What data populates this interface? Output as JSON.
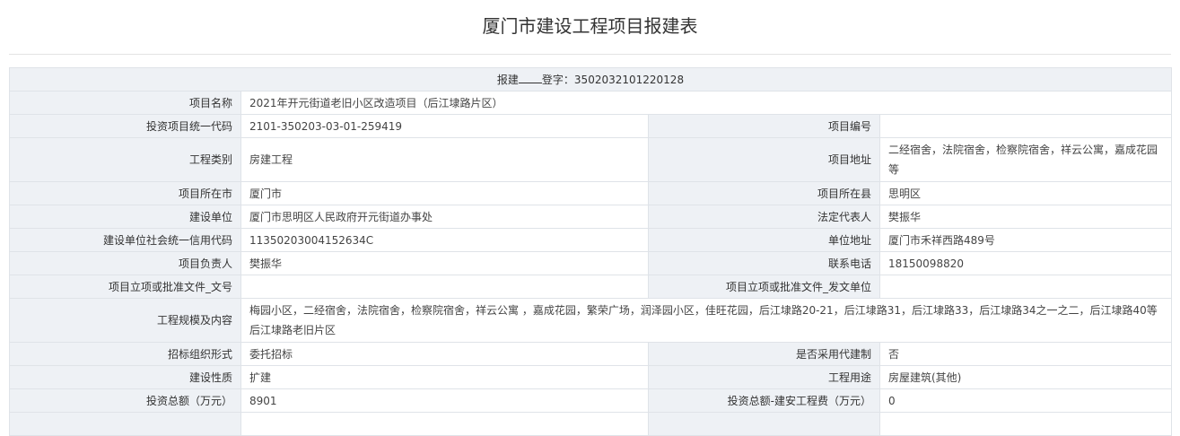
{
  "page": {
    "title": "厦门市建设工程项目报建表"
  },
  "header": {
    "prefix": "报建",
    "suffix": "登字：3502032101220128"
  },
  "rows": {
    "project_name": {
      "label": "项目名称",
      "value": "2021年开元街道老旧小区改造项目（后江埭路片区）"
    },
    "invest_code": {
      "label": "投资项目统一代码",
      "value": "2101-350203-03-01-259419"
    },
    "project_no": {
      "label": "项目编号",
      "value": ""
    },
    "project_type": {
      "label": "工程类别",
      "value": "房建工程"
    },
    "project_addr": {
      "label": "项目地址",
      "value": "二经宿舍，法院宿舍，检察院宿舍，祥云公寓，嘉成花园等"
    },
    "city": {
      "label": "项目所在市",
      "value": "厦门市"
    },
    "county": {
      "label": "项目所在县",
      "value": "思明区"
    },
    "builder": {
      "label": "建设单位",
      "value": "厦门市思明区人民政府开元街道办事处"
    },
    "legal_rep": {
      "label": "法定代表人",
      "value": "樊振华"
    },
    "credit_code": {
      "label": "建设单位社会统一信用代码",
      "value": "11350203004152634C"
    },
    "unit_addr": {
      "label": "单位地址",
      "value": "厦门市禾祥西路489号"
    },
    "manager": {
      "label": "项目负责人",
      "value": "樊振华"
    },
    "phone": {
      "label": "联系电话",
      "value": "18150098820"
    },
    "approval_no": {
      "label": "项目立项或批准文件_文号",
      "value": ""
    },
    "approval_unit": {
      "label": "项目立项或批准文件_发文单位",
      "value": ""
    },
    "scale": {
      "label": "工程规模及内容",
      "value": "梅园小区，二经宿舍，法院宿舍，检察院宿舍，祥云公寓 ，嘉成花园，繁荣广场，润泽园小区，佳旺花园，后江埭路20-21，后江埭路31，后江埭路33，后江埭路34之一之二，后江埭路40等后江埭路老旧片区"
    },
    "bidding": {
      "label": "招标组织形式",
      "value": "委托招标"
    },
    "agent_build": {
      "label": "是否采用代建制",
      "value": "否"
    },
    "nature": {
      "label": "建设性质",
      "value": "扩建"
    },
    "usage": {
      "label": "工程用途",
      "value": "房屋建筑(其他)"
    },
    "total_invest": {
      "label": "投资总额（万元）",
      "value": "8901"
    },
    "install_cost": {
      "label": "投资总额-建安工程费（万元）",
      "value": "0"
    }
  }
}
